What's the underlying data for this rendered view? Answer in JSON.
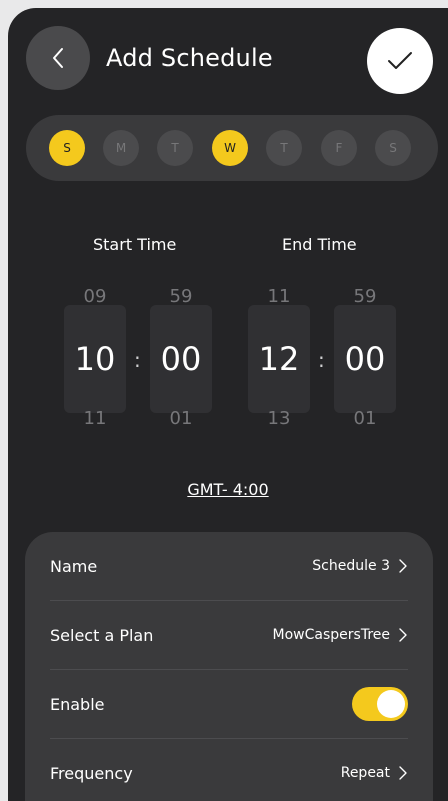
{
  "header": {
    "title": "Add Schedule"
  },
  "days": [
    {
      "label": "S",
      "selected": true
    },
    {
      "label": "M",
      "selected": false
    },
    {
      "label": "T",
      "selected": false
    },
    {
      "label": "W",
      "selected": true
    },
    {
      "label": "T",
      "selected": false
    },
    {
      "label": "F",
      "selected": false
    },
    {
      "label": "S",
      "selected": false
    }
  ],
  "start": {
    "label": "Start Time",
    "hour": {
      "prev": "09",
      "current": "10",
      "next": "11"
    },
    "minute": {
      "prev": "59",
      "current": "00",
      "next": "01"
    }
  },
  "end": {
    "label": "End Time",
    "hour": {
      "prev": "11",
      "current": "12",
      "next": "13"
    },
    "minute": {
      "prev": "59",
      "current": "00",
      "next": "01"
    }
  },
  "separator": ":",
  "timezone": "GMT- 4:00",
  "settings": {
    "name": {
      "label": "Name",
      "value": "Schedule 3"
    },
    "plan": {
      "label": "Select a Plan",
      "value": "MowCaspersTree"
    },
    "enable": {
      "label": "Enable",
      "on": true
    },
    "frequency": {
      "label": "Frequency",
      "value": "Repeat"
    }
  },
  "colors": {
    "accent": "#f4c91d",
    "background": "#242426",
    "card": "#3a3a3c"
  },
  "icons": {
    "back": "chevron-left-icon",
    "confirm": "check-icon",
    "row": "chevron-right-icon"
  }
}
